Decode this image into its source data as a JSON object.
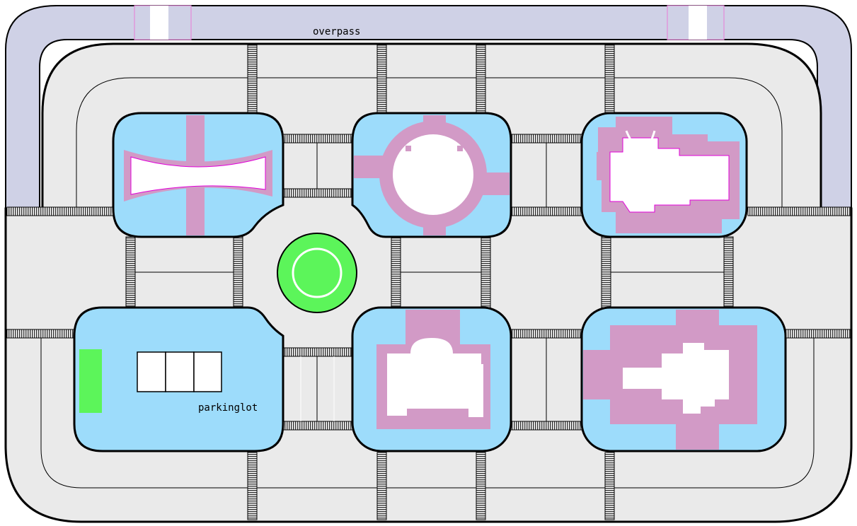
{
  "map": {
    "overpass_label": "overpass",
    "parkinglot_label": "parkinglot",
    "colors": {
      "ground": "#eaeaea",
      "block_fill": "#9ddcfb",
      "building_pink": "#d29ac6",
      "overpass": "#cfd1e6",
      "roundabout": "#5cf55a",
      "parking_green": "#5cf55a"
    },
    "parking_spaces": 3
  }
}
